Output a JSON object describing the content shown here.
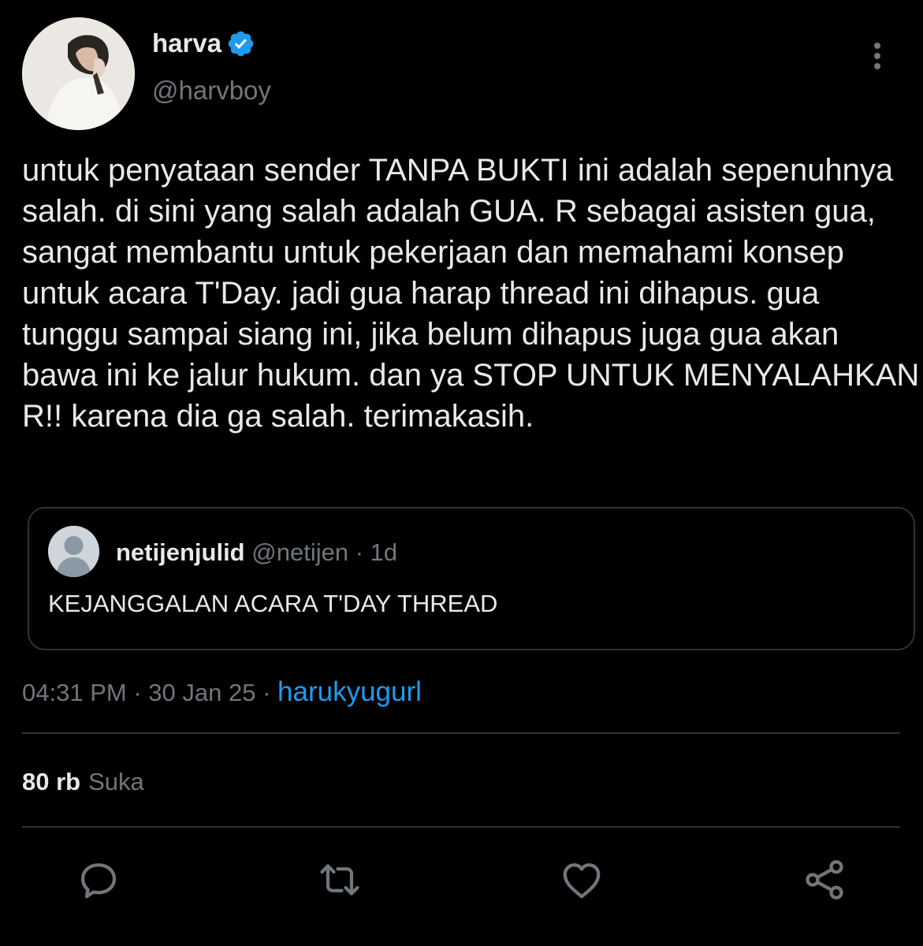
{
  "author": {
    "display_name": "harva",
    "handle": "@harvboy"
  },
  "tweet": {
    "text": "untuk penyataan sender TANPA BUKTI ini adalah sepenuhnya salah. di sini yang salah adalah GUA. R sebagai asisten gua, sangat membantu untuk pekerjaan dan memahami konsep untuk acara T'Day. jadi gua harap thread ini dihapus. gua tunggu sampai siang ini, jika belum dihapus juga gua akan bawa ini ke jalur hukum. dan ya STOP UNTUK MENYALAHKAN R!! karena dia ga salah. terimakasih."
  },
  "quoted": {
    "display_name": "netijenjulid",
    "handle": "@netijen",
    "separator": "·",
    "age": "1d",
    "text": "KEJANGGALAN ACARA T'DAY THREAD"
  },
  "meta": {
    "time": "04:31 PM",
    "dot1": "·",
    "date": "30 Jan 25",
    "dot2": "·",
    "via": "harukyugurl"
  },
  "stats": {
    "likes_count": "80 rb",
    "likes_label": "Suka"
  },
  "icons": {
    "verified": "verified-badge-icon",
    "more": "more-vertical-icon",
    "reply": "reply-icon",
    "retweet": "retweet-icon",
    "like": "heart-icon",
    "share": "share-icon"
  },
  "colors": {
    "background": "#000000",
    "text": "#e7e9ea",
    "muted": "#71767b",
    "accent": "#1d9bf0",
    "border": "#2f3336"
  }
}
